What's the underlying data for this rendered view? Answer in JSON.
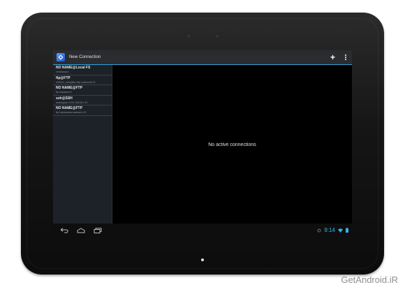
{
  "actionbar": {
    "title": "New Connection",
    "icons": {
      "app": "app-logo-icon",
      "add": "add-icon",
      "overflow": "overflow-menu-icon"
    },
    "add_label": "+"
  },
  "connections": [
    {
      "name": "NO NAME@Local FS",
      "detail": "/mnt/sdcard"
    },
    {
      "name": "ftp@FTP",
      "detail": "s09431_xofst@ftp://ftp.xofst.mobi:21"
    },
    {
      "name": "NO NAME@FTP",
      "detail": "ftp://asdasd:21"
    },
    {
      "name": "ssh@SSH",
      "detail": "andreyjosh://192.168.56.1:22"
    },
    {
      "name": "NO NAME@FTP",
      "detail": "ftp://asdasdasd.asdasd.ir:21"
    }
  ],
  "main": {
    "empty_message": "No active connections"
  },
  "statusbar": {
    "time": "9:14"
  },
  "navbar": {
    "icons": [
      "back-icon",
      "home-icon",
      "recent-apps-icon"
    ]
  },
  "watermark": "GetAndroid.iR",
  "colors": {
    "accent": "#33b5e5",
    "actionbar": "#2a2c30",
    "sidebar": "#1d2229",
    "bezel": "#151515"
  }
}
